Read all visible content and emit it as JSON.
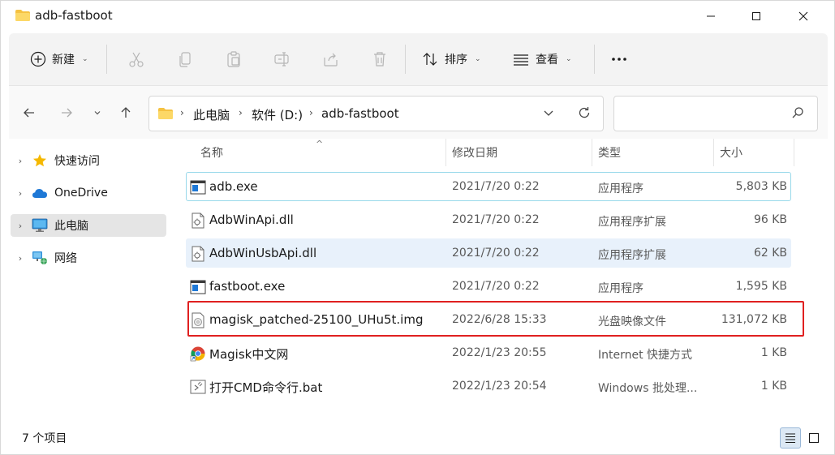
{
  "window": {
    "title": "adb-fastboot"
  },
  "toolbar": {
    "new_label": "新建",
    "sort_label": "排序",
    "view_label": "查看"
  },
  "nav": {
    "breadcrumbs": [
      "此电脑",
      "软件 (D:)",
      "adb-fastboot"
    ],
    "search_placeholder": ""
  },
  "sidebar": {
    "items": [
      {
        "label": "快速访问",
        "icon": "star-icon"
      },
      {
        "label": "OneDrive",
        "icon": "cloud-icon"
      },
      {
        "label": "此电脑",
        "icon": "computer-icon",
        "selected": true
      },
      {
        "label": "网络",
        "icon": "network-icon"
      }
    ]
  },
  "columns": {
    "name": "名称",
    "date": "修改日期",
    "type": "类型",
    "size": "大小"
  },
  "files": [
    {
      "name": "adb.exe",
      "date": "2021/7/20 0:22",
      "type": "应用程序",
      "size": "5,803 KB",
      "icon": "exe-icon"
    },
    {
      "name": "AdbWinApi.dll",
      "date": "2021/7/20 0:22",
      "type": "应用程序扩展",
      "size": "96 KB",
      "icon": "dll-icon"
    },
    {
      "name": "AdbWinUsbApi.dll",
      "date": "2021/7/20 0:22",
      "type": "应用程序扩展",
      "size": "62 KB",
      "icon": "dll-icon"
    },
    {
      "name": "fastboot.exe",
      "date": "2021/7/20 0:22",
      "type": "应用程序",
      "size": "1,595 KB",
      "icon": "exe-icon"
    },
    {
      "name": "magisk_patched-25100_UHu5t.img",
      "date": "2022/6/28 15:33",
      "type": "光盘映像文件",
      "size": "131,072 KB",
      "icon": "disc-image-icon"
    },
    {
      "name": "Magisk中文网",
      "date": "2022/1/23 20:55",
      "type": "Internet 快捷方式",
      "size": "1 KB",
      "icon": "chrome-shortcut-icon"
    },
    {
      "name": "打开CMD命令行.bat",
      "date": "2022/1/23 20:54",
      "type": "Windows 批处理...",
      "size": "1 KB",
      "icon": "bat-icon"
    }
  ],
  "status": {
    "item_count": "7 个项目"
  },
  "colors": {
    "highlight": "#e02020",
    "selection": "#e5e5e5",
    "folder": "#f5c242"
  }
}
